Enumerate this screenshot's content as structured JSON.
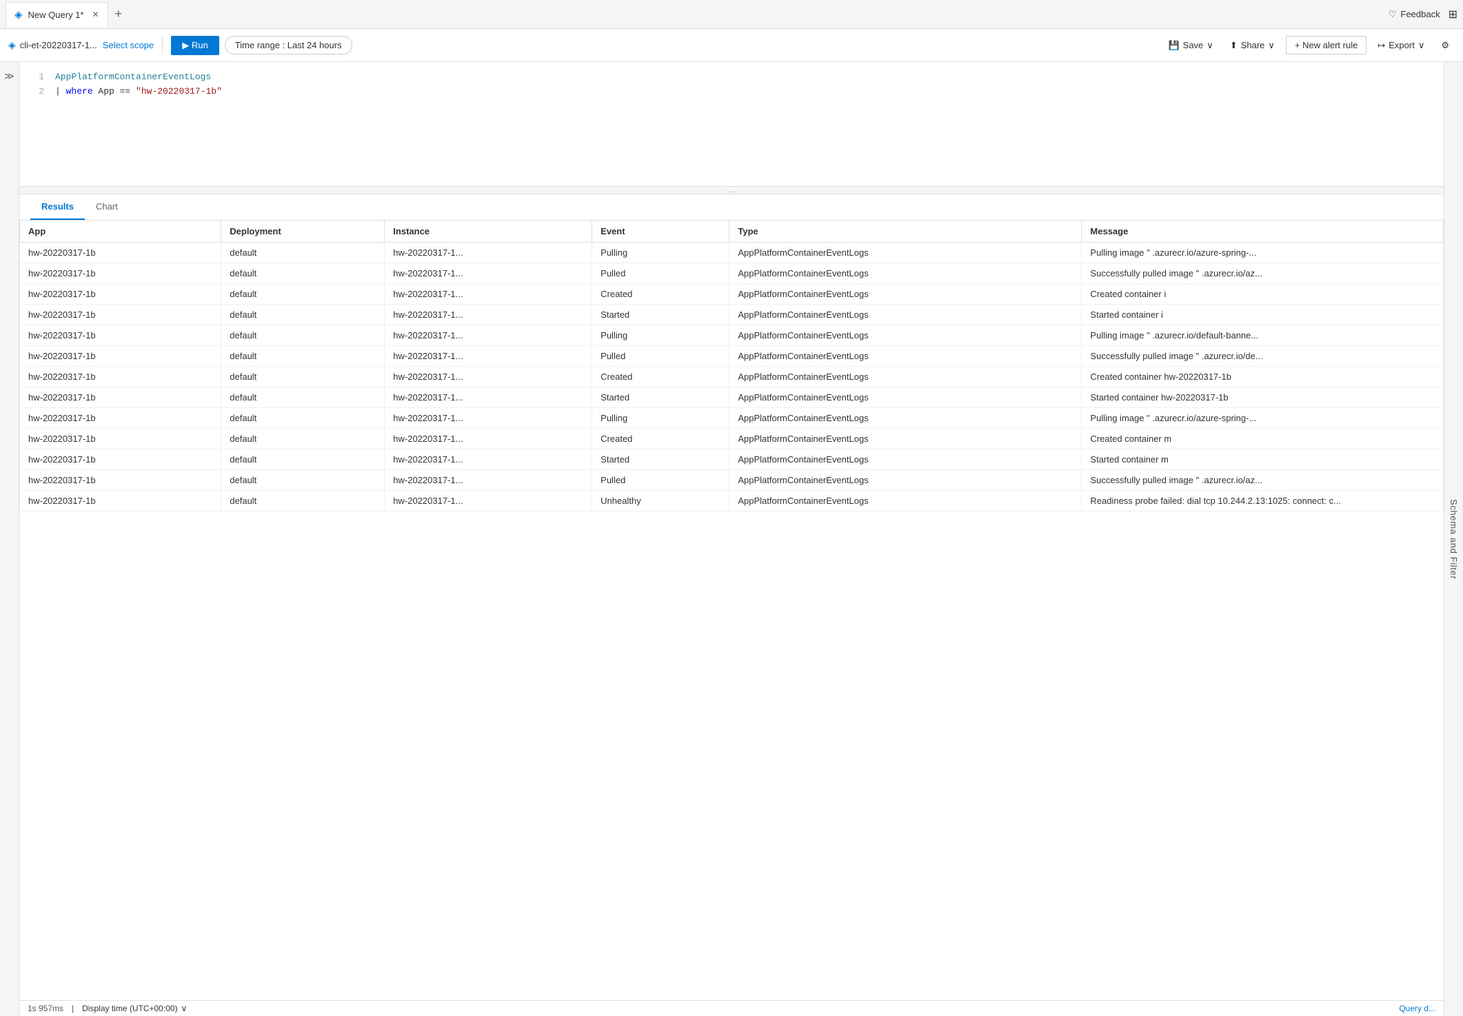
{
  "tabs": [
    {
      "id": "new-query-1",
      "label": "New Query 1*",
      "active": true,
      "icon": "◈"
    }
  ],
  "tab_add_label": "+",
  "feedback": {
    "label": "Feedback",
    "icon": "♡"
  },
  "grid_icon": "⊞",
  "toolbar": {
    "scope_icon": "◈",
    "scope_name": "cli-et-20220317-1...",
    "select_scope_label": "Select scope",
    "run_label": "▶ Run",
    "time_range_label": "Time range : Last 24 hours",
    "save_label": "Save",
    "share_label": "Share",
    "new_alert_label": "+ New alert rule",
    "export_label": "Export"
  },
  "editor": {
    "lines": [
      {
        "num": "1",
        "content": "AppPlatformContainerEventLogs"
      },
      {
        "num": "2",
        "content": "| where App == \"hw-20220317-1b\""
      }
    ]
  },
  "drag_handle": "...",
  "results": {
    "tabs": [
      {
        "label": "Results",
        "active": true
      },
      {
        "label": "Chart",
        "active": false
      }
    ],
    "columns": [
      "App",
      "Deployment",
      "Instance",
      "Event",
      "Type",
      "Message"
    ],
    "rows": [
      [
        "hw-20220317-1b",
        "default",
        "hw-20220317-1...",
        "Pulling",
        "AppPlatformContainerEventLogs",
        "Pulling image \"  .azurecr.io/azure-spring-..."
      ],
      [
        "hw-20220317-1b",
        "default",
        "hw-20220317-1...",
        "Pulled",
        "AppPlatformContainerEventLogs",
        "Successfully pulled image \"  .azurecr.io/az..."
      ],
      [
        "hw-20220317-1b",
        "default",
        "hw-20220317-1...",
        "Created",
        "AppPlatformContainerEventLogs",
        "Created container i"
      ],
      [
        "hw-20220317-1b",
        "default",
        "hw-20220317-1...",
        "Started",
        "AppPlatformContainerEventLogs",
        "Started container i"
      ],
      [
        "hw-20220317-1b",
        "default",
        "hw-20220317-1...",
        "Pulling",
        "AppPlatformContainerEventLogs",
        "Pulling image \"  .azurecr.io/default-banne..."
      ],
      [
        "hw-20220317-1b",
        "default",
        "hw-20220317-1...",
        "Pulled",
        "AppPlatformContainerEventLogs",
        "Successfully pulled image \"  .azurecr.io/de..."
      ],
      [
        "hw-20220317-1b",
        "default",
        "hw-20220317-1...",
        "Created",
        "AppPlatformContainerEventLogs",
        "Created container hw-20220317-1b"
      ],
      [
        "hw-20220317-1b",
        "default",
        "hw-20220317-1...",
        "Started",
        "AppPlatformContainerEventLogs",
        "Started container hw-20220317-1b"
      ],
      [
        "hw-20220317-1b",
        "default",
        "hw-20220317-1...",
        "Pulling",
        "AppPlatformContainerEventLogs",
        "Pulling image \"  .azurecr.io/azure-spring-..."
      ],
      [
        "hw-20220317-1b",
        "default",
        "hw-20220317-1...",
        "Created",
        "AppPlatformContainerEventLogs",
        "Created container m"
      ],
      [
        "hw-20220317-1b",
        "default",
        "hw-20220317-1...",
        "Started",
        "AppPlatformContainerEventLogs",
        "Started container m"
      ],
      [
        "hw-20220317-1b",
        "default",
        "hw-20220317-1...",
        "Pulled",
        "AppPlatformContainerEventLogs",
        "Successfully pulled image \"  .azurecr.io/az..."
      ],
      [
        "hw-20220317-1b",
        "default",
        "hw-20220317-1...",
        "Unhealthy",
        "AppPlatformContainerEventLogs",
        "Readiness probe failed: dial tcp 10.244.2.13:1025: connect: c..."
      ]
    ]
  },
  "status": {
    "duration": "1s 957ms",
    "time_label": "Display time (UTC+00:00)",
    "query_details": "Query d..."
  },
  "schema_panel_label": "Schema and Filter"
}
